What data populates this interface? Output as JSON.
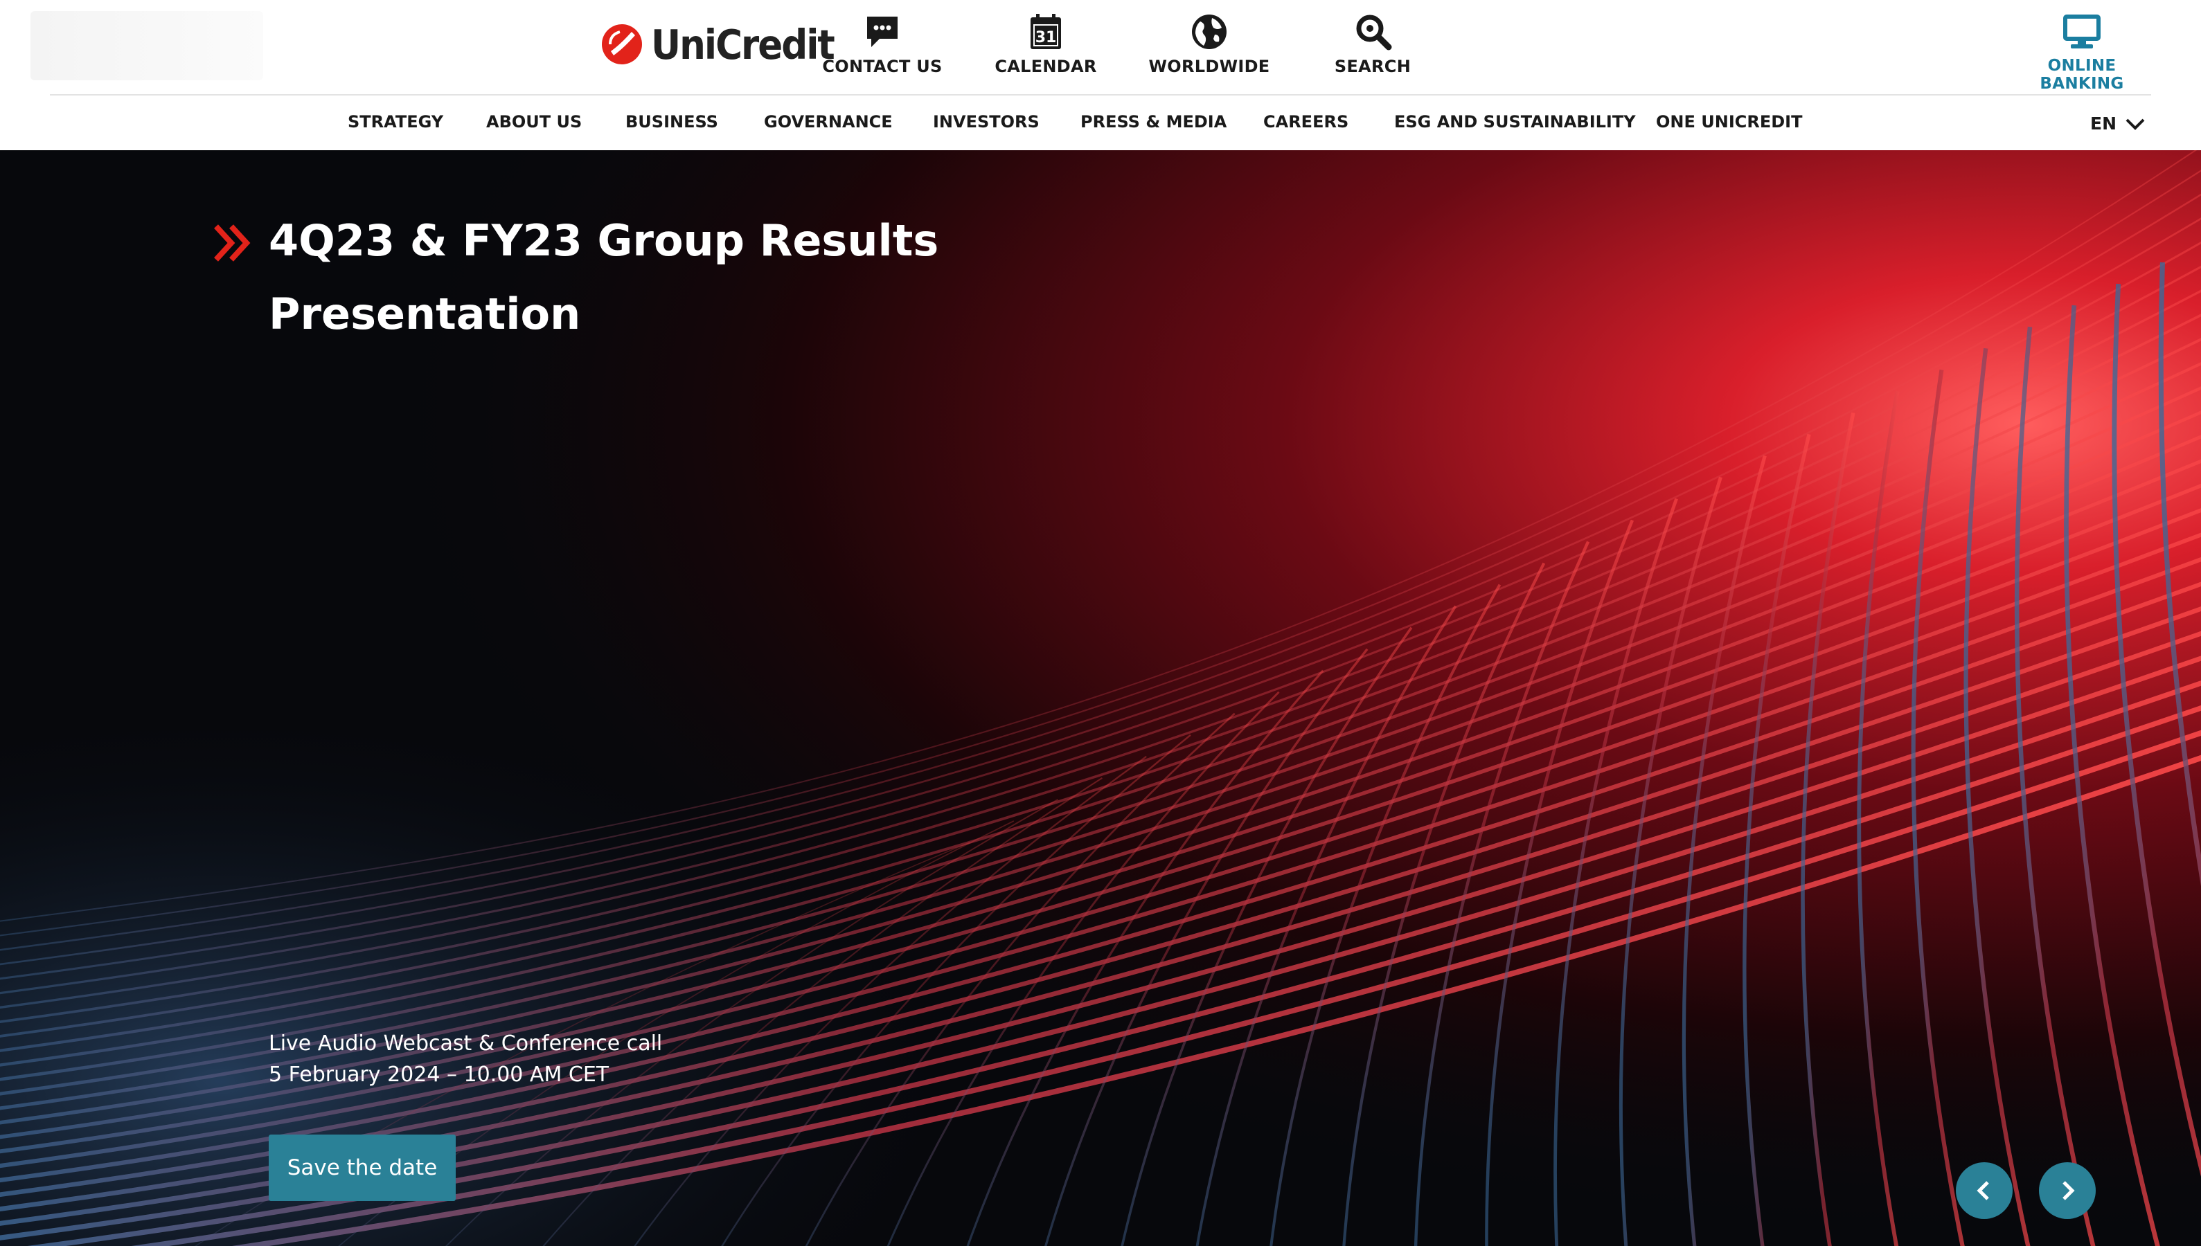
{
  "brand": {
    "name": "UniCredit",
    "accent": "#e2231a",
    "teal": "#2a8197"
  },
  "utility_nav": [
    {
      "label": "CONTACT US",
      "icon": "chat-icon"
    },
    {
      "label": "CALENDAR",
      "icon": "calendar-icon",
      "day": "31"
    },
    {
      "label": "WORLDWIDE",
      "icon": "globe-icon"
    },
    {
      "label": "SEARCH",
      "icon": "search-icon"
    }
  ],
  "online_banking": {
    "label": "ONLINE BANKING",
    "icon": "monitor-icon",
    "color": "#1b7ea0"
  },
  "main_nav": [
    "STRATEGY",
    "ABOUT US",
    "BUSINESS",
    "GOVERNANCE",
    "INVESTORS",
    "PRESS & MEDIA",
    "CAREERS",
    "ESG AND SUSTAINABILITY",
    "ONE UNICREDIT"
  ],
  "language": {
    "current": "EN"
  },
  "hero": {
    "title": "4Q23 & FY23 Group Results Presentation",
    "subtitle_line1": "Live Audio Webcast & Conference call",
    "subtitle_line2": "5 February 2024 – 10.00 AM CET",
    "cta_label": "Save the date"
  }
}
